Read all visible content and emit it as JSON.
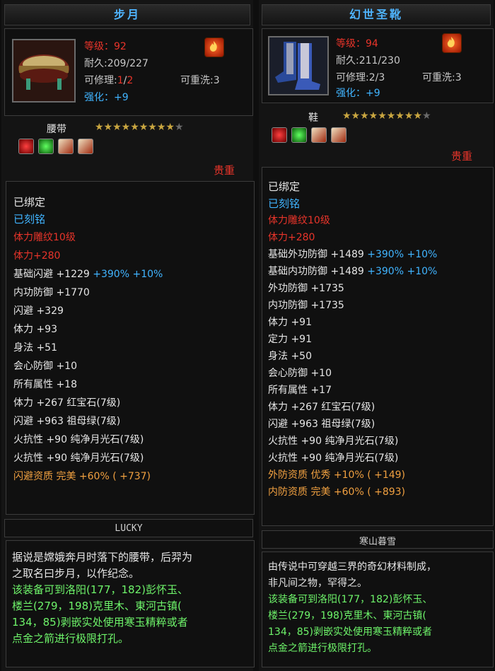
{
  "left": {
    "name": "步月",
    "level_label": "等级：92",
    "durability": "耐久:209/227",
    "repair_prefix": "可修理:",
    "repair_cur": "1",
    "repair_sep": "/",
    "repair_max": "2",
    "rewash": "可重洗:3",
    "enhance": "强化：+9",
    "type": "腰带",
    "stars_lit": 9,
    "stars_total": 10,
    "rarity": "贵重",
    "bound": "已绑定",
    "engraved": "已刻铭",
    "stats": [
      {
        "text": "体力雕纹10级",
        "color": "red"
      },
      {
        "text": "体力+280",
        "color": "red"
      },
      {
        "text": "基础闪避 +1229",
        "extra": " +390% +10%",
        "color": "white"
      },
      {
        "text": "内功防御 +1770",
        "color": "white"
      },
      {
        "text": "闪避  +329",
        "color": "white"
      },
      {
        "text": "体力  +93",
        "color": "white"
      },
      {
        "text": "身法  +51",
        "color": "white"
      },
      {
        "text": "会心防御 +10",
        "color": "white"
      },
      {
        "text": "所有属性 +18",
        "color": "white"
      },
      {
        "text": "体力  +267  红宝石(7级)",
        "color": "white"
      },
      {
        "text": "闪避  +963  祖母绿(7级)",
        "color": "white"
      },
      {
        "text": "火抗性  +90  纯净月光石(7级)",
        "color": "white"
      },
      {
        "text": "火抗性  +90  纯净月光石(7级)",
        "color": "white"
      },
      {
        "text": "闪避资质    完美  +60% ( +737)",
        "color": "orange"
      }
    ],
    "lucky": "LUCKY",
    "desc_white": [
      "据说是嫦娥奔月时落下的腰带，后羿为",
      "之取名曰步月，以作纪念。"
    ],
    "desc_green": [
      "该装备可到洛阳(177，182)彭怀玉、",
      "楼兰(279，198)克里木、東河古镇(",
      "134，85)剥嵌实处使用寒玉精粹或者",
      "点金之箭进行极限打孔。"
    ]
  },
  "right": {
    "name": "幻世圣靴",
    "level_label": "等级：94",
    "durability": "耐久:211/230",
    "repair": "可修理:2/3",
    "rewash": "可重洗:3",
    "enhance": "强化：+9",
    "type": "鞋",
    "stars_lit": 9,
    "stars_total": 10,
    "rarity": "贵重",
    "bound": "已绑定",
    "engraved": "已刻铭",
    "stats": [
      {
        "text": "体力雕纹10级",
        "color": "red"
      },
      {
        "text": "体力+280",
        "color": "red"
      },
      {
        "text": "基础外功防御 +1489",
        "extra": " +390% +10%",
        "color": "white"
      },
      {
        "text": "基础内功防御 +1489",
        "extra": " +390% +10%",
        "color": "white"
      },
      {
        "text": "外功防御  +1735",
        "color": "white"
      },
      {
        "text": "内功防御  +1735",
        "color": "white"
      },
      {
        "text": "体力  +91",
        "color": "white"
      },
      {
        "text": "定力  +91",
        "color": "white"
      },
      {
        "text": "身法  +50",
        "color": "white"
      },
      {
        "text": "会心防御 +10",
        "color": "white"
      },
      {
        "text": "所有属性 +17",
        "color": "white"
      },
      {
        "text": "体力  +267  红宝石(7级)",
        "color": "white"
      },
      {
        "text": "闪避  +963  祖母绿(7级)",
        "color": "white"
      },
      {
        "text": "火抗性  +90  纯净月光石(7级)",
        "color": "white"
      },
      {
        "text": "火抗性  +90  纯净月光石(7级)",
        "color": "white"
      },
      {
        "text": "外防资质    优秀  +10% ( +149)",
        "color": "orange"
      },
      {
        "text": "内防资质    完美  +60% ( +893)",
        "color": "orange"
      }
    ],
    "lucky": "寒山暮雪",
    "desc_white": [
      "由传说中可穿越三界的奇幻材料制成，",
      "非凡间之物，罕得之。"
    ],
    "desc_green": [
      "该装备可到洛阳(177，182)彭怀玉、",
      "楼兰(279，198)克里木、東河古镇(",
      "134，85)剥嵌实处使用寒玉精粹或者",
      "点金之箭进行极限打孔。"
    ]
  },
  "colors": {
    "red": "#e8342a",
    "blue": "#40b4ff",
    "white": "#e6e6e6",
    "green": "#6ef46a",
    "orange": "#f0a040",
    "title": "#4fb4ff"
  }
}
